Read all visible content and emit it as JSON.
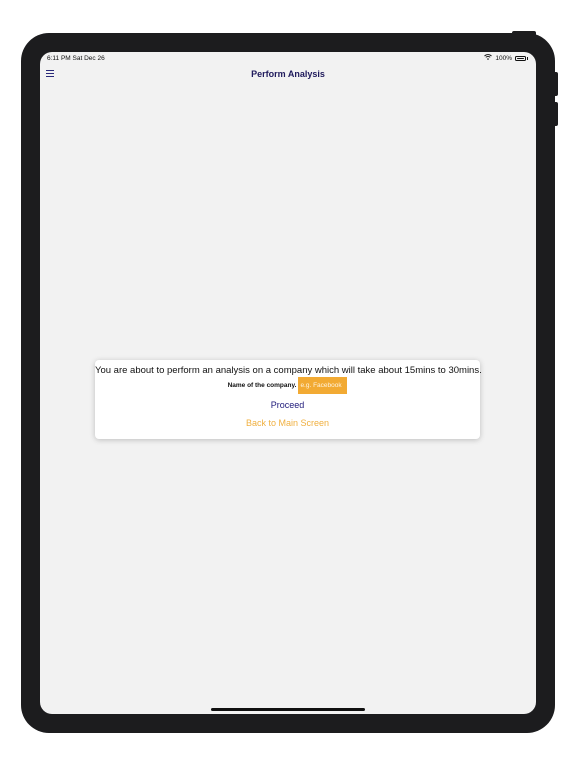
{
  "status_bar": {
    "time_date": "6:11 PM  Sat Dec 26",
    "wifi_icon": "wifi-icon",
    "battery_percent": "100%",
    "battery_level": 1.0
  },
  "nav": {
    "menu_icon": "hamburger-menu-icon",
    "title": "Perform Analysis"
  },
  "dialog": {
    "message": "You are about to perform an analysis on a company which will take about 15mins to 30mins.",
    "company_label": "Name of the company.",
    "company_input_value": "",
    "company_input_placeholder": "e.g. Facebook",
    "proceed_label": "Proceed",
    "back_label": "Back to Main Screen"
  },
  "colors": {
    "accent_orange": "#f2aa33",
    "title_navy": "#1f1a5c",
    "background": "#f2f2f2"
  }
}
